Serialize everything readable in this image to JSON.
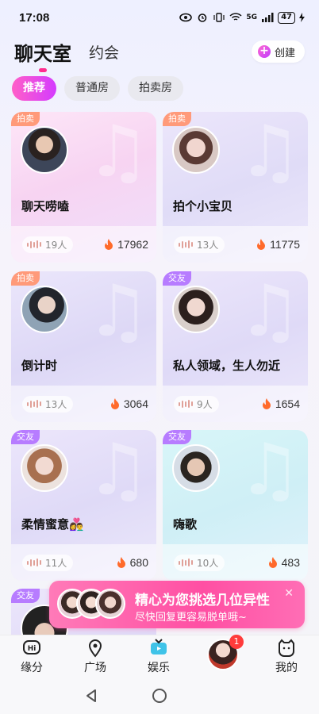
{
  "status": {
    "time": "17:08",
    "battery": "47",
    "network": "5G"
  },
  "header": {
    "title": "聊天室",
    "secondary_tab": "约会",
    "create_label": "创建"
  },
  "filters": [
    "推荐",
    "普通房",
    "拍卖房"
  ],
  "rooms": [
    {
      "tag": "拍卖",
      "title": "聊天唠嗑",
      "people": "19人",
      "heat": "17962"
    },
    {
      "tag": "拍卖",
      "title": "拍个小宝贝",
      "people": "13人",
      "heat": "11775"
    },
    {
      "tag": "拍卖",
      "title": "倒计时",
      "people": "13人",
      "heat": "3064"
    },
    {
      "tag": "交友",
      "title": "私人领域，生人勿近",
      "people": "9人",
      "heat": "1654"
    },
    {
      "tag": "交友",
      "title": "柔情蜜意👩‍❤️‍👨",
      "people": "11人",
      "heat": "680"
    },
    {
      "tag": "交友",
      "title": "嗨歌",
      "people": "10人",
      "heat": "483"
    },
    {
      "tag": "交友"
    }
  ],
  "promo": {
    "line1": "精心为您挑选几位异性",
    "line2": "尽快回复更容易脱单哦~"
  },
  "tabbar": {
    "items": [
      "缘分",
      "广场",
      "娱乐",
      "",
      "我的"
    ],
    "badge": "1"
  },
  "colors": {
    "accent": "#ff2d8f",
    "tag_sale": "#ff9a7a",
    "tag_friend": "#b77cff"
  }
}
